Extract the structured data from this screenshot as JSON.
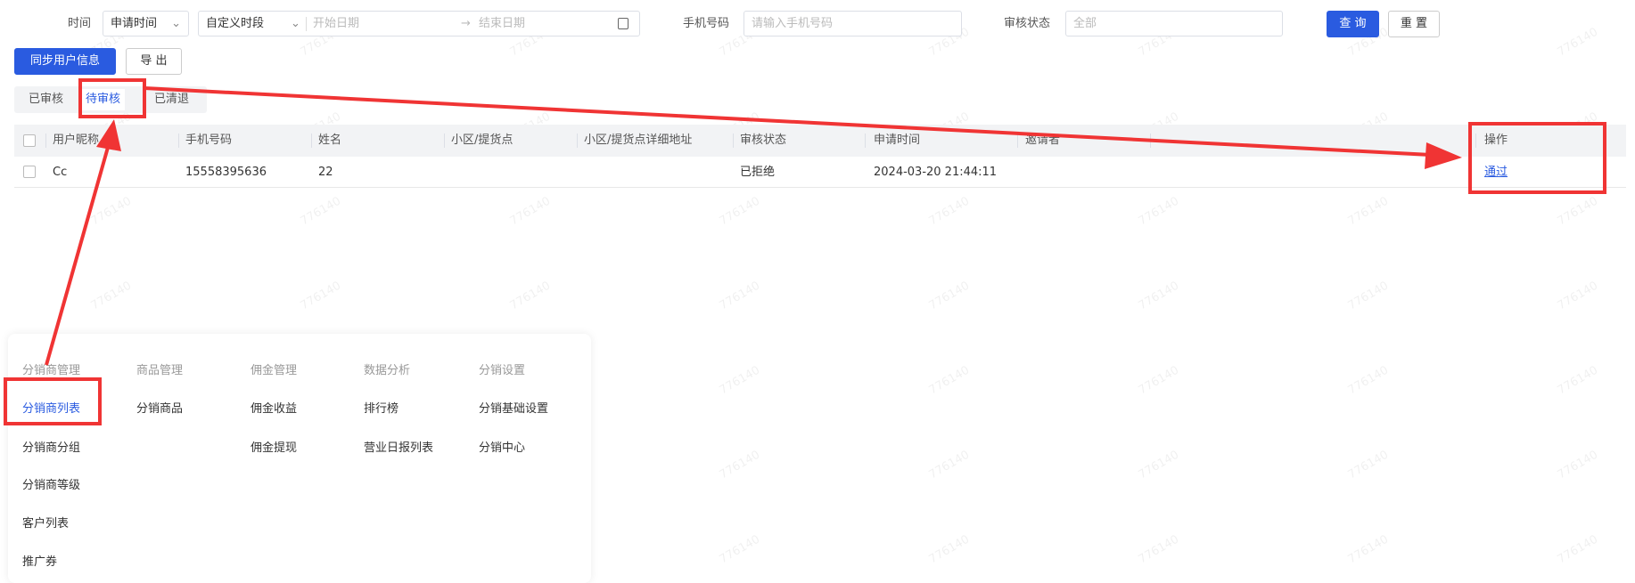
{
  "watermark": "776140",
  "filters": {
    "time_label": "时间",
    "time_type": "申请时间",
    "range_type": "自定义时段",
    "start_placeholder": "开始日期",
    "range_sep": "→",
    "end_placeholder": "结束日期",
    "phone_label": "手机号码",
    "phone_placeholder": "请输入手机号码",
    "status_label": "审核状态",
    "status_value": "全部",
    "query": "查 询",
    "reset": "重 置"
  },
  "actions": {
    "sync": "同步用户信息",
    "export": "导 出"
  },
  "tabs": [
    {
      "label": "已审核"
    },
    {
      "label": "待审核",
      "active": true
    },
    {
      "label": "已清退"
    }
  ],
  "table": {
    "columns": [
      "用户昵称",
      "手机号码",
      "姓名",
      "小区/提货点",
      "小区/提货点详细地址",
      "审核状态",
      "申请时间",
      "邀请者",
      "操作"
    ],
    "rows": [
      {
        "nickname": "Cc",
        "phone": "15558395636",
        "name": "22",
        "community": "",
        "address": "",
        "status": "已拒绝",
        "applied": "2024-03-20 21:44:11",
        "inviter": "",
        "action": "通过"
      }
    ]
  },
  "menu": {
    "columns": [
      {
        "title": "分销商管理",
        "items": [
          "分销商列表",
          "分销商分组",
          "分销商等级",
          "客户列表",
          "推广券"
        ]
      },
      {
        "title": "商品管理",
        "items": [
          "分销商品"
        ]
      },
      {
        "title": "佣金管理",
        "items": [
          "佣金收益",
          "佣金提现"
        ]
      },
      {
        "title": "数据分析",
        "items": [
          "排行榜",
          "营业日报列表"
        ]
      },
      {
        "title": "分销设置",
        "items": [
          "分销基础设置",
          "分销中心"
        ]
      }
    ],
    "active": "分销商列表"
  },
  "colors": {
    "primary": "#2a5be0",
    "annotation": "#f03434"
  }
}
